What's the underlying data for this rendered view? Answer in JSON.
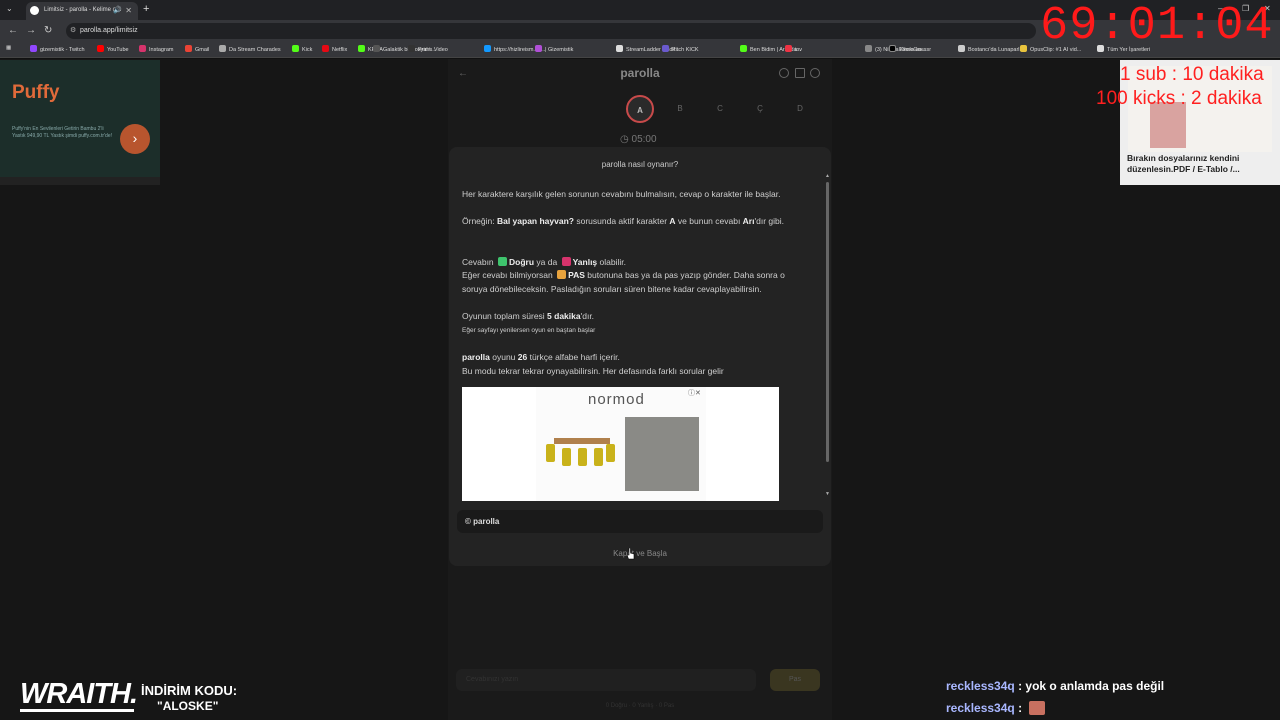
{
  "browser": {
    "tab_title": "Limitsiz - parolla - Kelime o...",
    "url": "parolla.app/limitsiz",
    "bookmarks": [
      "gizemistik - Twitch",
      "YouTube",
      "Instagram",
      "Gmail",
      "Da Stream Charades",
      "Kick",
      "Netflix",
      "KREA",
      "Galaktik bir sosyal t...",
      "Prime Video",
      "https://hizlireism.co...",
      "| Gizemistik",
      "StreamLadder - Edit...",
      "Pitch KICK",
      "Ben Bidim | Arkada...",
      "inv",
      "(3) Nikola Kesla on...",
      "EthnoGuessr",
      "Bostancı'da Lunaparl...",
      "OpusClip: #1 AI vid...",
      "Tüm Yer İşaretleri"
    ]
  },
  "ad_left": {
    "brand": "Puffy",
    "text": "Puffy'nin En Sevilenleri Getirin Bambu 2'li Yastık 949,90 TL Yastık şimdi puffy.com.tr'de!"
  },
  "ad_right": {
    "caption": "Bırakın dosyalarınız kendini düzenlesin.PDF / E-Tablo /..."
  },
  "app": {
    "title": "parolla",
    "letters": [
      "A",
      "B",
      "C",
      "Ç",
      "D"
    ],
    "timer": "05:00",
    "answer_placeholder": "Cevabınızı yazın",
    "ok_label": "Pas",
    "stats": "0 Doğru  ·  0 Yanlış  ·  0 Pas"
  },
  "modal": {
    "title": "parolla nasıl oynanır?",
    "p1": "Her karaktere karşılık gelen sorunun cevabını bulmalısın, cevap o karakter ile başlar.",
    "p2_a": "Örneğin: ",
    "p2_b": "Bal yapan hayvan?",
    "p2_c": " sorusunda aktif karakter ",
    "p2_d": "A",
    "p2_e": " ve bunun cevabı ",
    "p2_f": "Arı",
    "p2_g": "'dır gibi.",
    "p3_a": "Cevabın ",
    "p3_b": "Doğru",
    "p3_c": " ya da ",
    "p3_d": "Yanlış",
    "p3_e": " olabilir.",
    "p4_a": "Eğer cevabı bilmiyorsan ",
    "p4_b": "PAS",
    "p4_c": " butonuna bas ya da pas yazıp gönder. Daha sonra o soruya dönebileceksin. Pasladığın soruları süren bitene kadar cevaplayabilirsin.",
    "p5_a": "Oyunun toplam süresi ",
    "p5_b": "5 dakika",
    "p5_c": "'dır.",
    "p5_small": "Eğer sayfayı yenilersen oyun en baştan başlar",
    "p6_a": "parolla",
    "p6_b": " oyunu ",
    "p6_c": "26",
    "p6_d": " türkçe alfabe harfi içerir.",
    "p7": "Bu modu tekrar tekrar oynayabilirsin. Her defasında farklı sorular gelir",
    "ad_logo": "normod",
    "footer": "© parolla",
    "close_label": "Kapat ve Başla",
    "colors": {
      "correct": "#3ec46d",
      "wrong": "#d6336c",
      "pass": "#e8a33d"
    }
  },
  "overlay": {
    "timer": "69:01:04",
    "line1": "1 sub : 10 dakika",
    "line2": "100 kicks : 2 dakika",
    "sponsor": "WRAITH.",
    "code_label": "İNDİRİM KODU:",
    "code_value": "\"ALOSKE\""
  },
  "chat": [
    {
      "user": "reckless34q",
      "message": "yok o anlamda pas değil"
    },
    {
      "user": "reckless34q",
      "message": ""
    }
  ]
}
